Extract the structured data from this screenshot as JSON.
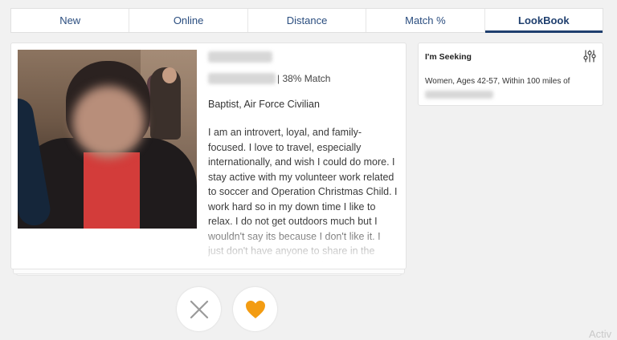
{
  "tabs": [
    {
      "label": "New",
      "active": false
    },
    {
      "label": "Online",
      "active": false
    },
    {
      "label": "Distance",
      "active": false
    },
    {
      "label": "Match %",
      "active": false
    },
    {
      "label": "LookBook",
      "active": true
    }
  ],
  "profile": {
    "match_text": "| 38% Match",
    "religion_occupation": "Baptist, Air Force Civilian",
    "about": "I am an introvert, loyal, and family-focused.    I love to travel, especially internationally, and wish I could do more.    I stay active with my volunteer work related to soccer and Operation Christmas Child.    I work hard so in my down time I like to relax.    I do not get outdoors much but I wouldn't say its because I don't like it. I just don't have anyone to share in the adventures.    I am looking for someone to"
  },
  "seeking": {
    "title": "I'm Seeking",
    "criteria": "Women, Ages 42-57, Within 100 miles of"
  },
  "actions": {
    "pass_icon": "x-icon",
    "like_icon": "heart-icon",
    "like_color": "#f39c12"
  },
  "watermark": "Activ"
}
